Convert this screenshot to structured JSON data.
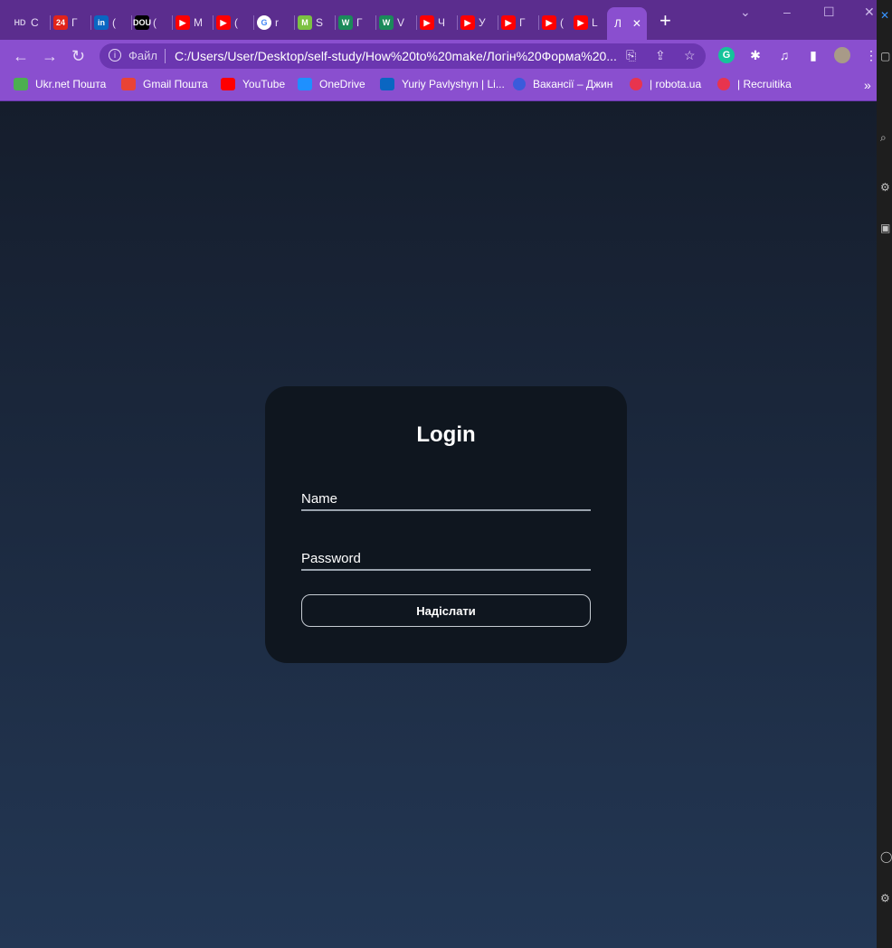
{
  "browser": {
    "tabs": [
      {
        "icon": "hd-icon",
        "badge": "HD",
        "color": "#5b2d8e",
        "text": "С"
      },
      {
        "icon": "24-news-icon",
        "badge": "24",
        "color": "#e2231a",
        "text": "Г"
      },
      {
        "icon": "linkedin-icon",
        "badge": "in",
        "color": "#0a66c2",
        "text": "("
      },
      {
        "icon": "dou-icon",
        "badge": "DOU",
        "color": "#000000",
        "text": "("
      },
      {
        "icon": "youtube-icon",
        "badge": "▶",
        "color": "#ff0000",
        "text": "М"
      },
      {
        "icon": "youtube-icon",
        "badge": "▶",
        "color": "#ff0000",
        "text": "("
      },
      {
        "icon": "google-icon",
        "badge": "G",
        "color": "#ffffff",
        "text": "r"
      },
      {
        "icon": "m-icon",
        "badge": "M",
        "color": "#7cc142",
        "text": "S"
      },
      {
        "icon": "w-icon",
        "badge": "W",
        "color": "#1b8a5a",
        "text": "Г"
      },
      {
        "icon": "w-icon",
        "badge": "W",
        "color": "#1b8a5a",
        "text": "V"
      },
      {
        "icon": "youtube-icon",
        "badge": "▶",
        "color": "#ff0000",
        "text": "Ч"
      },
      {
        "icon": "youtube-icon",
        "badge": "▶",
        "color": "#ff0000",
        "text": "У"
      },
      {
        "icon": "youtube-icon",
        "badge": "▶",
        "color": "#ff0000",
        "text": "Г"
      },
      {
        "icon": "youtube-icon",
        "badge": "▶",
        "color": "#ff0000",
        "text": "("
      },
      {
        "icon": "youtube-icon",
        "badge": "▶",
        "color": "#ff0000",
        "text": "L"
      }
    ],
    "active_tab": {
      "text": "Л",
      "close": "✕"
    },
    "new_tab": "+",
    "file_label": "Файл",
    "url": "C:/Users/User/Desktop/self-study/How%20to%20make/Логін%20Форма%20...",
    "bookmarks": [
      {
        "icon": "ukrnet-icon",
        "label": "Ukr.net Пошта",
        "color": "#4caf50"
      },
      {
        "icon": "gmail-icon",
        "label": "Gmail Пошта",
        "color": "#ea4335"
      },
      {
        "icon": "youtube-icon",
        "label": "YouTube",
        "color": "#ff0000"
      },
      {
        "icon": "onedrive-icon",
        "label": "OneDrive",
        "color": "#1e90ff"
      },
      {
        "icon": "linkedin-icon",
        "label": "Yuriy Pavlyshyn | Li...",
        "color": "#0a66c2"
      },
      {
        "icon": "djinni-icon",
        "label": "Вакансії – Джин",
        "color": "#3b5bdb"
      },
      {
        "icon": "robota-icon",
        "label": "| robota.ua",
        "color": "#e8344e"
      },
      {
        "icon": "recruitika-icon",
        "label": "| Recruitika",
        "color": "#e8344e"
      }
    ],
    "bookmarks_more": "»"
  },
  "login": {
    "title": "Login",
    "name_label": "Name",
    "password_label": "Password",
    "submit_label": "Надіслати"
  }
}
